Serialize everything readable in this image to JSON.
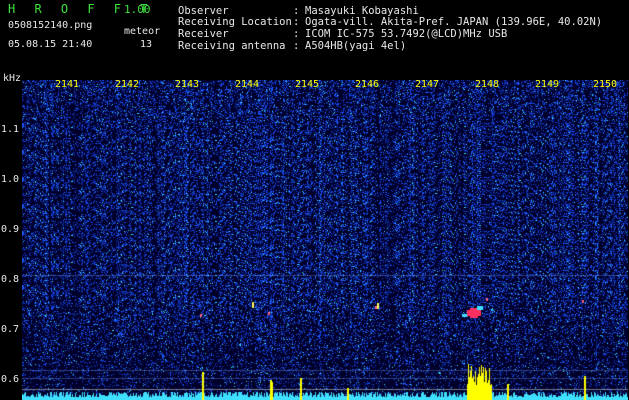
{
  "header": {
    "title": "H R O F F T",
    "version": "1.00",
    "filename": "0508152140.png",
    "mode": "meteor",
    "datetime": "05.08.15 21:40",
    "count": "13"
  },
  "info": [
    {
      "key": "Observer",
      "value": "Masayuki Kobayashi"
    },
    {
      "key": "Receiving Location",
      "value": "Ogata-vill. Akita-Pref. JAPAN (139.96E, 40.02N)"
    },
    {
      "key": "Receiver",
      "value": "ICOM IC-575 53.7492(@LCD)MHz USB"
    },
    {
      "key": "Receiving antenna",
      "value": "A504HB(yagi 4el)"
    }
  ],
  "axis": {
    "unit": "kHz",
    "freq_labels": [
      "1.1",
      "1.0",
      "0.9",
      "0.8",
      "0.7",
      "0.6"
    ],
    "minute_labels": [
      "2141",
      "2142",
      "2143",
      "2144",
      "2145",
      "2146",
      "2147",
      "2148",
      "2149",
      "2150"
    ]
  },
  "colors": {
    "header_green": "#3ee43e",
    "label_yellow": "#ffff00",
    "noise_blue": "#1d3cff",
    "trace_cyan": "#3fe0ff",
    "meteor_red": "#ff3060"
  }
}
